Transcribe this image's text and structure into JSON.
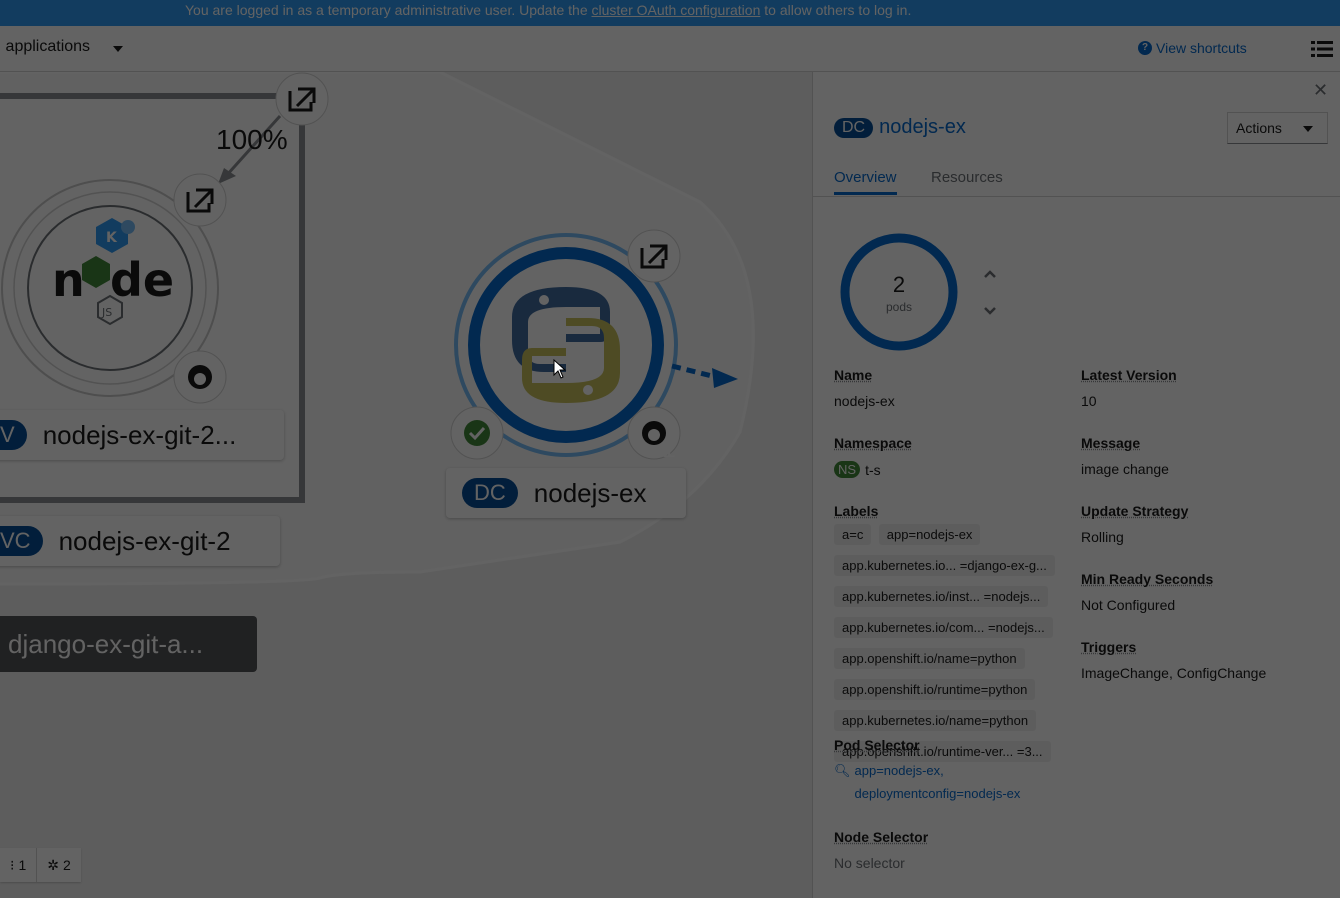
{
  "banner": {
    "text_before": "You are logged in as a temporary administrative user. Update the ",
    "link": "cluster OAuth configuration",
    "text_after": " to allow others to log in."
  },
  "toolbar": {
    "app_selector": "ll applications",
    "view_shortcuts": "View shortcuts",
    "list_icon": "list-view-icon"
  },
  "topology": {
    "traffic_percent": "100%",
    "knative_service": {
      "badge": "V",
      "name": "nodejs-ex-git-2..."
    },
    "knative_config": {
      "badge": "VC",
      "name": "nodejs-ex-git-2"
    },
    "django_group": {
      "name": "django-ex-git-a..."
    },
    "python_node": {
      "badge": "DC",
      "name": "nodejs-ex",
      "builds": "1"
    },
    "zoom": [
      {
        "icon": "topology-icon",
        "value": "1"
      },
      {
        "icon": "graph-icon",
        "value": "2"
      }
    ]
  },
  "panel": {
    "resource": {
      "badge": "DC",
      "name": "nodejs-ex"
    },
    "actions_label": "Actions",
    "tabs": [
      "Overview",
      "Resources"
    ],
    "pods": {
      "count": "2",
      "label": "pods"
    },
    "fields": {
      "name": {
        "label": "Name",
        "value": "nodejs-ex"
      },
      "namespace": {
        "label": "Namespace",
        "badge": "NS",
        "value": "t-s"
      },
      "labels_title": "Labels",
      "labels": [
        "a=c",
        "app=nodejs-ex",
        "app.kubernetes.io... =django-ex-g...",
        "app.kubernetes.io/inst... =nodejs...",
        "app.kubernetes.io/com... =nodejs...",
        "app.openshift.io/name=python",
        "app.openshift.io/runtime=python",
        "app.kubernetes.io/name=python",
        "app.openshift.io/runtime-ver... =3..."
      ],
      "pod_selector": {
        "label": "Pod Selector",
        "line1": "app=nodejs-ex,",
        "line2": "deploymentconfig=nodejs-ex"
      },
      "node_selector": {
        "label": "Node Selector",
        "value": "No selector"
      },
      "latest_version": {
        "label": "Latest Version",
        "value": "10"
      },
      "message": {
        "label": "Message",
        "value": "image change"
      },
      "update_strategy": {
        "label": "Update Strategy",
        "value": "Rolling"
      },
      "min_ready": {
        "label": "Min Ready Seconds",
        "value": "Not Configured"
      },
      "triggers": {
        "label": "Triggers",
        "value": "ImageChange, ConfigChange"
      }
    }
  },
  "colors": {
    "banner": "#2b9af3",
    "link": "#0066cc",
    "badge_dc": "#004b95",
    "badge_ns": "#3e8635"
  }
}
